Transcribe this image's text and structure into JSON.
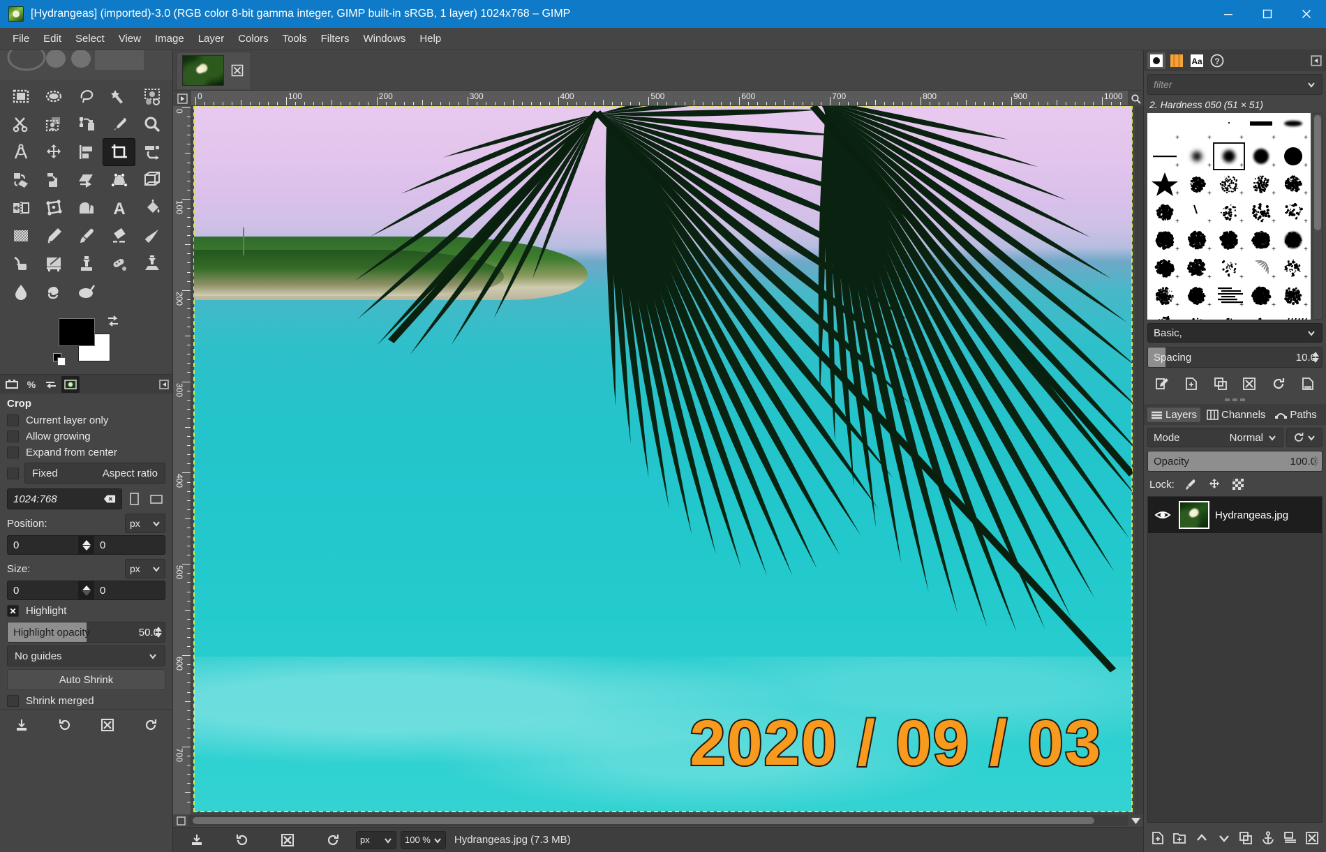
{
  "window": {
    "title": "[Hydrangeas] (imported)-3.0 (RGB color 8-bit gamma integer, GIMP built-in sRGB, 1 layer) 1024x768 – GIMP",
    "icon": "gimp-wilber-icon",
    "minimize": "minimize-button",
    "maximize": "maximize-button",
    "close": "close-button",
    "accent_color": "#0f7ac7"
  },
  "menubar": {
    "items": [
      {
        "label": "File"
      },
      {
        "label": "Edit"
      },
      {
        "label": "Select"
      },
      {
        "label": "View"
      },
      {
        "label": "Image"
      },
      {
        "label": "Layer"
      },
      {
        "label": "Colors"
      },
      {
        "label": "Tools"
      },
      {
        "label": "Filters"
      },
      {
        "label": "Windows"
      },
      {
        "label": "Help"
      }
    ]
  },
  "toolbox": {
    "tools": [
      "rect-select-icon",
      "ellipse-select-icon",
      "free-select-icon",
      "fuzzy-select-icon",
      "select-by-color-icon",
      "scissors-select-icon",
      "foreground-select-icon",
      "paths-icon",
      "color-picker-icon",
      "zoom-icon",
      "measure-icon",
      "move-icon",
      "align-icon",
      "crop-icon",
      "transform-icon",
      "rotate-icon",
      "scale-icon",
      "shear-icon",
      "perspective-icon",
      "3d-transform-icon",
      "flip-icon",
      "handle-transform-icon",
      "warp-transform-icon",
      "text-icon",
      "bucket-fill-icon",
      "gradient-icon",
      "pencil-icon",
      "paintbrush-icon",
      "eraser-icon",
      "airbrush-icon",
      "ink-icon",
      "mypaint-brush-icon",
      "clone-icon",
      "heal-icon",
      "perspective-clone-icon",
      "blur-sharpen-icon",
      "smudge-icon",
      "dodge-burn-icon"
    ],
    "selected_index": 13,
    "selected_name": "crop-icon",
    "foreground_color": "#000000",
    "background_color": "#ffffff"
  },
  "tool_options": {
    "mini_tabs": [
      "tool-options-icon",
      "device-status-icon",
      "undo-history-icon",
      "images-icon"
    ],
    "mini_active_index": 3,
    "title": "Crop",
    "checkboxes": [
      {
        "label": "Current layer only",
        "checked": false
      },
      {
        "label": "Allow growing",
        "checked": false
      },
      {
        "label": "Expand from center",
        "checked": false
      }
    ],
    "fixed": {
      "checked": false,
      "label": "Fixed",
      "value": "Aspect ratio"
    },
    "ratio": {
      "value": "1024:768",
      "clear_icon": "clear-entry-icon",
      "portrait_icon": "portrait-icon",
      "landscape_icon": "landscape-icon"
    },
    "position": {
      "label": "Position:",
      "unit": "px",
      "x": "0",
      "y": "0"
    },
    "size": {
      "label": "Size:",
      "unit": "px",
      "w": "0",
      "h": "0"
    },
    "highlight": {
      "label": "Highlight",
      "checked": true
    },
    "highlight_opacity": {
      "label": "Highlight opacity",
      "value": "50.0",
      "percent": 50
    },
    "guides": {
      "value": "No guides"
    },
    "auto_shrink": {
      "label": "Auto Shrink"
    },
    "shrink_merged": {
      "label": "Shrink merged",
      "checked": false
    },
    "bottom_icons": [
      "save-options-icon",
      "restore-options-icon",
      "delete-options-icon",
      "reset-options-icon"
    ]
  },
  "image_tab": {
    "thumbnail": "hydrangeas-thumbnail",
    "close_icon": "close-tab-icon"
  },
  "canvas": {
    "h_ruler_labels": [
      "0",
      "100",
      "200",
      "300",
      "400",
      "500",
      "600",
      "700",
      "800",
      "900",
      "1000"
    ],
    "v_ruler_labels": [
      "0",
      "100",
      "200",
      "300",
      "400",
      "500",
      "600",
      "700"
    ],
    "h_ruler_step": 100,
    "overlay_text": "2020 / 09 / 03",
    "overlay_color": "#f79a1e",
    "overlay_stroke": "#221a10",
    "quick_mask_icon": "quick-mask-icon",
    "nav_icon": "navigation-icon",
    "menu_arrow_icon": "menu-arrow-icon"
  },
  "statusbar": {
    "icons": [
      "save-icon",
      "undo-icon",
      "cancel-icon",
      "redo-icon"
    ],
    "unit": "px",
    "zoom": "100 %",
    "message": "Hydrangeas.jpg (7.3 MB)"
  },
  "brushes_dock": {
    "tabs": [
      "brushes-icon",
      "patterns-icon",
      "fonts-icon",
      "document-history-icon"
    ],
    "active_tab_index": 0,
    "menu_icon": "dock-menu-icon",
    "filter_placeholder": "filter",
    "filter_value": "",
    "chevron_icon": "chevron-down-icon",
    "selected_brush": "2. Hardness 050 (51 × 51)",
    "selected_cell_index": 7,
    "tag_combo": "Basic,",
    "spacing": {
      "label": "Spacing",
      "value": "10.0",
      "percent": 10
    },
    "actions": [
      "edit-brush-icon",
      "new-brush-icon",
      "duplicate-brush-icon",
      "delete-brush-icon",
      "refresh-brushes-icon",
      "open-as-image-icon"
    ]
  },
  "layers_dock": {
    "tabs": [
      {
        "label": "Layers",
        "icon": "layers-icon",
        "active": true
      },
      {
        "label": "Channels",
        "icon": "channels-icon",
        "active": false
      },
      {
        "label": "Paths",
        "icon": "paths-icon",
        "active": false
      }
    ],
    "menu_icon": "dock-menu-icon",
    "mode": {
      "label": "Mode",
      "value": "Normal"
    },
    "opacity": {
      "label": "Opacity",
      "value": "100.0",
      "percent": 100
    },
    "lock": {
      "label": "Lock:",
      "items": [
        "lock-pixels-icon",
        "lock-position-icon",
        "lock-alpha-icon"
      ]
    },
    "layers": [
      {
        "name": "Hydrangeas.jpg",
        "visible": true,
        "thumbnail": "hydrangeas-layer-thumbnail",
        "selected": true
      }
    ],
    "bottom_actions": [
      "new-layer-icon",
      "new-layer-group-icon",
      "raise-layer-icon",
      "lower-layer-icon",
      "duplicate-layer-icon",
      "anchor-layer-icon",
      "merge-down-icon",
      "delete-layer-icon"
    ]
  }
}
